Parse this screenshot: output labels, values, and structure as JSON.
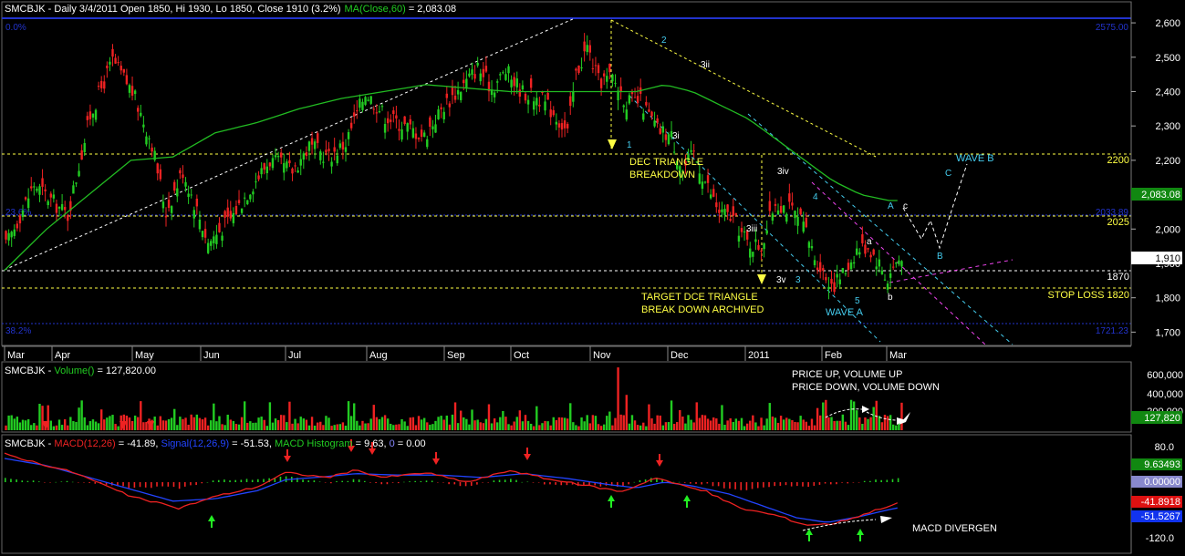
{
  "symbol_header": "SMCBJK - Daily 3/4/2011 Open 1850, Hi 1930, Lo 1850, Close 1910 (3.2%)",
  "ma_label": "MA(Close,60)",
  "ma_value": " = 2,083.08",
  "volume_header_prefix": "SMCBJK - ",
  "volume_header_name": "Volume()",
  "volume_header_value": " = 127,820.00",
  "macd_header": {
    "prefix": "SMCBJK - ",
    "macd": "MACD(12,26)",
    "macd_val": " = -41.89, ",
    "signal": "Signal(12,26,9)",
    "signal_val": " = -51.53, ",
    "hist": "MACD Histogram",
    "hist_val": " = 9.63, ",
    "zero": "0",
    "zero_val": " = 0.00"
  },
  "colors": {
    "background": "#000000",
    "up": "#22cc22",
    "down": "#ee2222",
    "ma": "#22bb22",
    "fib": "#2233cc",
    "annotation": "#ffff44",
    "wave": "#44ccee",
    "signal": "#2244ff",
    "macd": "#ee2222"
  },
  "chart_data": [
    {
      "type": "candlestick",
      "title": "SMCBJK - Daily 3/4/2011 Open 1850, Hi 1930, Lo 1850, Close 1910 (3.2%)",
      "x_labels": [
        "Mar",
        "Apr",
        "May",
        "Jun",
        "Jul",
        "Aug",
        "Sep",
        "Oct",
        "Nov",
        "Dec",
        "2011",
        "Feb",
        "Mar"
      ],
      "y_ticks": [
        "2,600",
        "2,500",
        "2,400",
        "2,300",
        "2,200",
        "2,100",
        "2,000",
        "1,900",
        "1,800",
        "1,700"
      ],
      "ylim": [
        1640,
        2640
      ],
      "price_path": [
        [
          0,
          1950
        ],
        [
          10,
          2130
        ],
        [
          22,
          2040
        ],
        [
          30,
          2330
        ],
        [
          38,
          2490
        ],
        [
          45,
          2400
        ],
        [
          52,
          2250
        ],
        [
          57,
          2050
        ],
        [
          63,
          2170
        ],
        [
          70,
          2010
        ],
        [
          72,
          1960
        ],
        [
          80,
          2030
        ],
        [
          87,
          2120
        ],
        [
          94,
          2200
        ],
        [
          102,
          2170
        ],
        [
          108,
          2240
        ],
        [
          115,
          2210
        ],
        [
          121,
          2250
        ],
        [
          128,
          2400
        ],
        [
          135,
          2330
        ],
        [
          142,
          2300
        ],
        [
          149,
          2270
        ],
        [
          156,
          2360
        ],
        [
          163,
          2420
        ],
        [
          168,
          2470
        ],
        [
          173,
          2410
        ],
        [
          178,
          2460
        ],
        [
          184,
          2400
        ],
        [
          190,
          2380
        ],
        [
          195,
          2340
        ],
        [
          200,
          2280
        ],
        [
          203,
          2450
        ],
        [
          207,
          2530
        ],
        [
          211,
          2430
        ],
        [
          216,
          2440
        ],
        [
          221,
          2370
        ],
        [
          226,
          2370
        ],
        [
          232,
          2290
        ],
        [
          237,
          2270
        ],
        [
          241,
          2170
        ],
        [
          245,
          2220
        ],
        [
          249,
          2140
        ],
        [
          254,
          2050
        ],
        [
          259,
          2030
        ],
        [
          264,
          1960
        ],
        [
          269,
          1950
        ],
        [
          274,
          2080
        ],
        [
          279,
          2060
        ],
        [
          284,
          2010
        ],
        [
          288,
          1920
        ],
        [
          292,
          1860
        ],
        [
          295,
          1840
        ],
        [
          299,
          1880
        ],
        [
          303,
          1940
        ],
        [
          307,
          1950
        ],
        [
          311,
          1900
        ],
        [
          314,
          1850
        ],
        [
          316,
          1890
        ],
        [
          318,
          1910
        ]
      ],
      "ma60_path": [
        [
          0,
          1880
        ],
        [
          15,
          2000
        ],
        [
          30,
          2100
        ],
        [
          45,
          2200
        ],
        [
          60,
          2210
        ],
        [
          75,
          2280
        ],
        [
          90,
          2310
        ],
        [
          105,
          2350
        ],
        [
          120,
          2380
        ],
        [
          135,
          2400
        ],
        [
          150,
          2420
        ],
        [
          165,
          2410
        ],
        [
          180,
          2400
        ],
        [
          195,
          2400
        ],
        [
          210,
          2400
        ],
        [
          225,
          2400
        ],
        [
          235,
          2420
        ],
        [
          245,
          2400
        ],
        [
          255,
          2360
        ],
        [
          265,
          2320
        ],
        [
          275,
          2260
        ],
        [
          285,
          2200
        ],
        [
          295,
          2140
        ],
        [
          305,
          2100
        ],
        [
          315,
          2083
        ]
      ],
      "fib_levels": [
        {
          "label": "0.0%",
          "value": 2575.0,
          "label_right": "2575.00"
        },
        {
          "label": "23.6%",
          "value": 2033,
          "label_right": "2033.89"
        },
        {
          "label": "38.2%",
          "value": 1721.23,
          "label_right": "1721.23"
        }
      ],
      "horizontal_levels": [
        {
          "value": 2200,
          "label": "2200"
        },
        {
          "value": 2025,
          "label": "2025"
        },
        {
          "value": 1870,
          "label": "1870"
        },
        {
          "value": 1820,
          "label": "STOP LOSS 1820"
        }
      ],
      "price_badges": [
        {
          "text": "2,083.08",
          "value": 2083.08
        },
        {
          "text": "1,910",
          "value": 1910
        }
      ],
      "annotations": [
        {
          "text": "DEC TRIANGLE",
          "color": "yellow"
        },
        {
          "text": "BREAKDOWN",
          "color": "yellow"
        },
        {
          "text": "TARGET DCE TRIANGLE",
          "color": "yellow"
        },
        {
          "text": "BREAK DOWN ARCHIVED",
          "color": "yellow"
        },
        {
          "text": "WAVE B",
          "color": "cyan"
        },
        {
          "text": "WAVE A",
          "color": "cyan"
        }
      ],
      "wave_labels": [
        "1",
        "2",
        "3ii",
        "3i",
        "3iii",
        "3iv",
        "3v",
        "3",
        "4",
        "5",
        "a",
        "b",
        "c",
        "A",
        "B",
        "C"
      ]
    },
    {
      "type": "bar",
      "title": "Volume()",
      "value": 127820.0,
      "y_ticks": [
        "600,000",
        "400,000",
        "200,000"
      ],
      "ylim": [
        0,
        650000
      ],
      "badge": "127,820",
      "annotations": [
        "PRICE UP, VOLUME UP",
        "PRICE DOWN, VOLUME DOWN"
      ]
    },
    {
      "type": "line",
      "title": "MACD(12,26)",
      "series": [
        {
          "name": "MACD(12,26)",
          "value": -41.89
        },
        {
          "name": "Signal(12,26,9)",
          "value": -51.53
        },
        {
          "name": "MACD Histogram",
          "value": 9.63
        }
      ],
      "y_ticks": [
        "80.0",
        "-120.0"
      ],
      "ylim": [
        -135,
        95
      ],
      "badges": [
        "9.63493",
        "0.00000",
        "-41.8918",
        "-51.5267"
      ],
      "annotations": [
        "MACD DIVERGEN"
      ]
    }
  ]
}
